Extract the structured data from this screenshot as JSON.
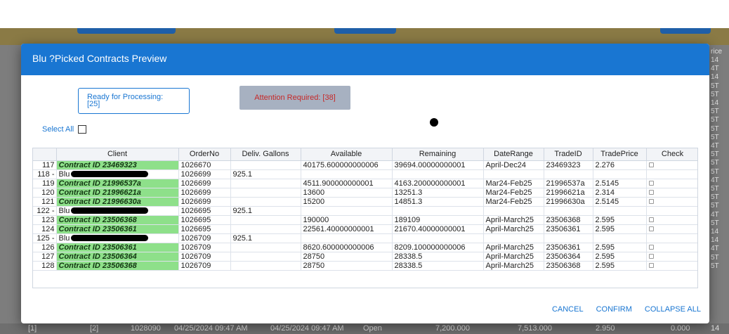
{
  "modal": {
    "title": "Blu ?Picked Contracts Preview",
    "ready_label": "Ready for Processing:",
    "ready_count": "[25]",
    "attention_label": "Attention Required: [38]",
    "select_all": "Select All",
    "footer": {
      "cancel": "CANCEL",
      "confirm": "CONFIRM",
      "collapse": "COLLAPSE ALL"
    }
  },
  "table": {
    "headers": [
      "",
      "Client",
      "OrderNo",
      "Deliv. Gallons",
      "Available",
      "Remaining",
      "DateRange",
      "TradeID",
      "TradePrice",
      "Check"
    ],
    "rows": [
      {
        "idx": "117",
        "client": "Contract ID 23469323",
        "green": true,
        "order": "1026670",
        "deliv": "",
        "avail": "40175.600000000006",
        "remain": "39694.00000000001",
        "range": "April-Dec24",
        "trade": "23469323",
        "price": "2.276",
        "check": true
      },
      {
        "idx": "118 -",
        "client": "Blu",
        "green": false,
        "order": "1026699",
        "deliv": "925.1",
        "avail": "",
        "remain": "",
        "range": "",
        "trade": "",
        "price": "",
        "check": false
      },
      {
        "idx": "119",
        "client": "Contract ID 21996537a",
        "green": true,
        "order": "1026699",
        "deliv": "",
        "avail": "4511.900000000001",
        "remain": "4163.200000000001",
        "range": "Mar24-Feb25",
        "trade": "21996537a",
        "price": "2.5145",
        "check": true
      },
      {
        "idx": "120",
        "client": "Contract ID 21996621a",
        "green": true,
        "order": "1026699",
        "deliv": "",
        "avail": "13600",
        "remain": "13251.3",
        "range": "Mar24-Feb25",
        "trade": "21996621a",
        "price": "2.314",
        "check": true
      },
      {
        "idx": "121",
        "client": "Contract ID 21996630a",
        "green": true,
        "order": "1026699",
        "deliv": "",
        "avail": "15200",
        "remain": "14851.3",
        "range": "Mar24-Feb25",
        "trade": "21996630a",
        "price": "2.5145",
        "check": true
      },
      {
        "idx": "122 -",
        "client": "Blu",
        "green": false,
        "order": "1026695",
        "deliv": "925.1",
        "avail": "",
        "remain": "",
        "range": "",
        "trade": "",
        "price": "",
        "check": false
      },
      {
        "idx": "123",
        "client": "Contract ID 23506368",
        "green": true,
        "order": "1026695",
        "deliv": "",
        "avail": "190000",
        "remain": "189109",
        "range": "April-March25",
        "trade": "23506368",
        "price": "2.595",
        "check": true
      },
      {
        "idx": "124",
        "client": "Contract ID 23506361",
        "green": true,
        "order": "1026695",
        "deliv": "",
        "avail": "22561.40000000001",
        "remain": "21670.40000000001",
        "range": "April-March25",
        "trade": "23506361",
        "price": "2.595",
        "check": true
      },
      {
        "idx": "125 -",
        "client": "Blu",
        "green": false,
        "order": "1026709",
        "deliv": "925.1",
        "avail": "",
        "remain": "",
        "range": "",
        "trade": "",
        "price": "",
        "check": false
      },
      {
        "idx": "126",
        "client": "Contract ID 23506361",
        "green": true,
        "order": "1026709",
        "deliv": "",
        "avail": "8620.600000000006",
        "remain": "8209.100000000006",
        "range": "April-March25",
        "trade": "23506361",
        "price": "2.595",
        "check": true
      },
      {
        "idx": "127",
        "client": "Contract ID 23506364",
        "green": true,
        "order": "1026709",
        "deliv": "",
        "avail": "28750",
        "remain": "28338.5",
        "range": "April-March25",
        "trade": "23506364",
        "price": "2.595",
        "check": true
      },
      {
        "idx": "128",
        "client": "Contract ID 23506368",
        "green": true,
        "order": "1026709",
        "deliv": "",
        "avail": "28750",
        "remain": "28338.5",
        "range": "April-March25",
        "trade": "23506368",
        "price": "2.595",
        "check": true
      }
    ]
  },
  "background": {
    "right_col_header": "rice",
    "right_col_cells": [
      "14",
      "4T",
      "14",
      "5T",
      "5T",
      "14",
      "5T",
      "5T",
      "5T",
      "5T",
      "4T",
      "5T",
      "5T",
      "5T",
      "4T",
      "5T",
      "5T",
      "5T",
      "4T",
      "5T",
      "14",
      "14",
      "4T",
      "5T",
      "5T"
    ],
    "bottom_row": [
      "[1]",
      "[2]",
      "1028090",
      "04/25/2024 09:47 AM",
      "04/25/2024 09:47 AM",
      "Open",
      "7,200.000",
      "7,513.000",
      "2.950",
      "0.000",
      "14"
    ]
  }
}
